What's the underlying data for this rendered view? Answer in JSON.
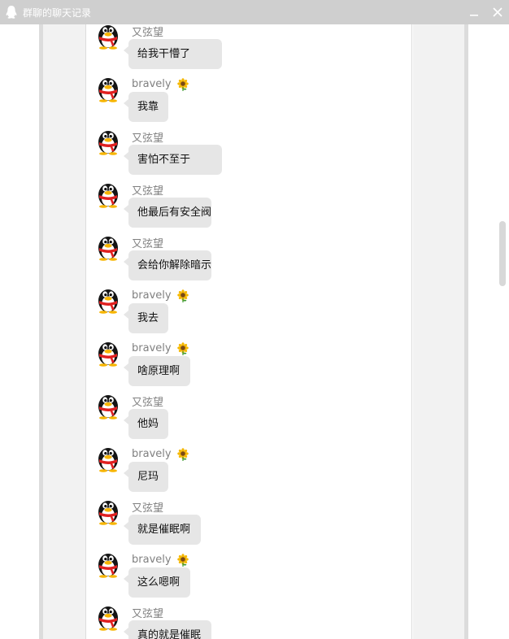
{
  "window": {
    "title": "群聊的聊天记录",
    "title_icon": "qq-penguin-icon",
    "minimize_icon": "minimize-icon",
    "close_icon": "close-icon"
  },
  "colors": {
    "titlebar": "#cfcfcf",
    "bubble": "#e6e6e6",
    "sender_name": "#808080",
    "panel": "#f2f2f2"
  },
  "messages": [
    {
      "sender": "又弦望",
      "text": "给我干懵了",
      "badge": ""
    },
    {
      "sender": "bravely",
      "text": "我靠",
      "badge": "sunflower-icon"
    },
    {
      "sender": "又弦望",
      "text": "害怕不至于",
      "badge": ""
    },
    {
      "sender": "又弦望",
      "text": "他最后有安全阀",
      "badge": ""
    },
    {
      "sender": "又弦望",
      "text": "会给你解除暗示",
      "badge": ""
    },
    {
      "sender": "bravely",
      "text": "我去",
      "badge": "sunflower-icon"
    },
    {
      "sender": "bravely",
      "text": "啥原理啊",
      "badge": "sunflower-icon"
    },
    {
      "sender": "又弦望",
      "text": "他妈",
      "badge": ""
    },
    {
      "sender": "bravely",
      "text": "尼玛",
      "badge": "sunflower-icon"
    },
    {
      "sender": "又弦望",
      "text": "就是催眠啊",
      "badge": ""
    },
    {
      "sender": "bravely",
      "text": "这么嗯啊",
      "badge": "sunflower-icon"
    },
    {
      "sender": "又弦望",
      "text": "真的就是催眠",
      "badge": ""
    }
  ]
}
